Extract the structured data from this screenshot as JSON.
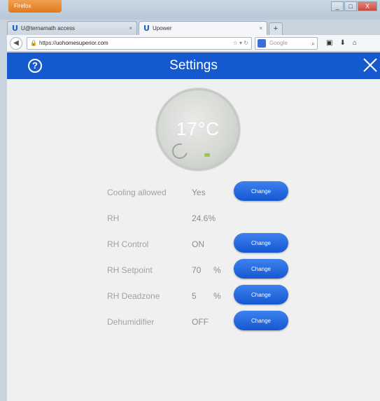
{
  "browser": {
    "app_button": "Firefox",
    "tabs": [
      {
        "title": "U@ternamath access",
        "active": false
      },
      {
        "title": "Upower",
        "active": true
      }
    ],
    "new_tab": "+",
    "url_prefix": "https://",
    "url_host": "uohomesuperior.com",
    "search_placeholder": "Google",
    "window_controls": [
      "_",
      "□",
      "X"
    ]
  },
  "app": {
    "title": "Settings",
    "accent_color": "#1559cf",
    "dial": {
      "temperature": "17°C"
    },
    "settings": [
      {
        "label": "Cooling allowed",
        "value": "Yes",
        "unit": "",
        "button": "Change"
      },
      {
        "label": "RH",
        "value": "24.6%",
        "unit": "",
        "button": ""
      },
      {
        "label": "RH Control",
        "value": "ON",
        "unit": "",
        "button": "Change"
      },
      {
        "label": "RH Setpoint",
        "value": "70",
        "unit": "%",
        "button": "Change"
      },
      {
        "label": "RH Deadzone",
        "value": "5",
        "unit": "%",
        "button": "Change"
      },
      {
        "label": "Dehumidifier",
        "value": "OFF",
        "unit": "",
        "button": "Change"
      }
    ]
  }
}
